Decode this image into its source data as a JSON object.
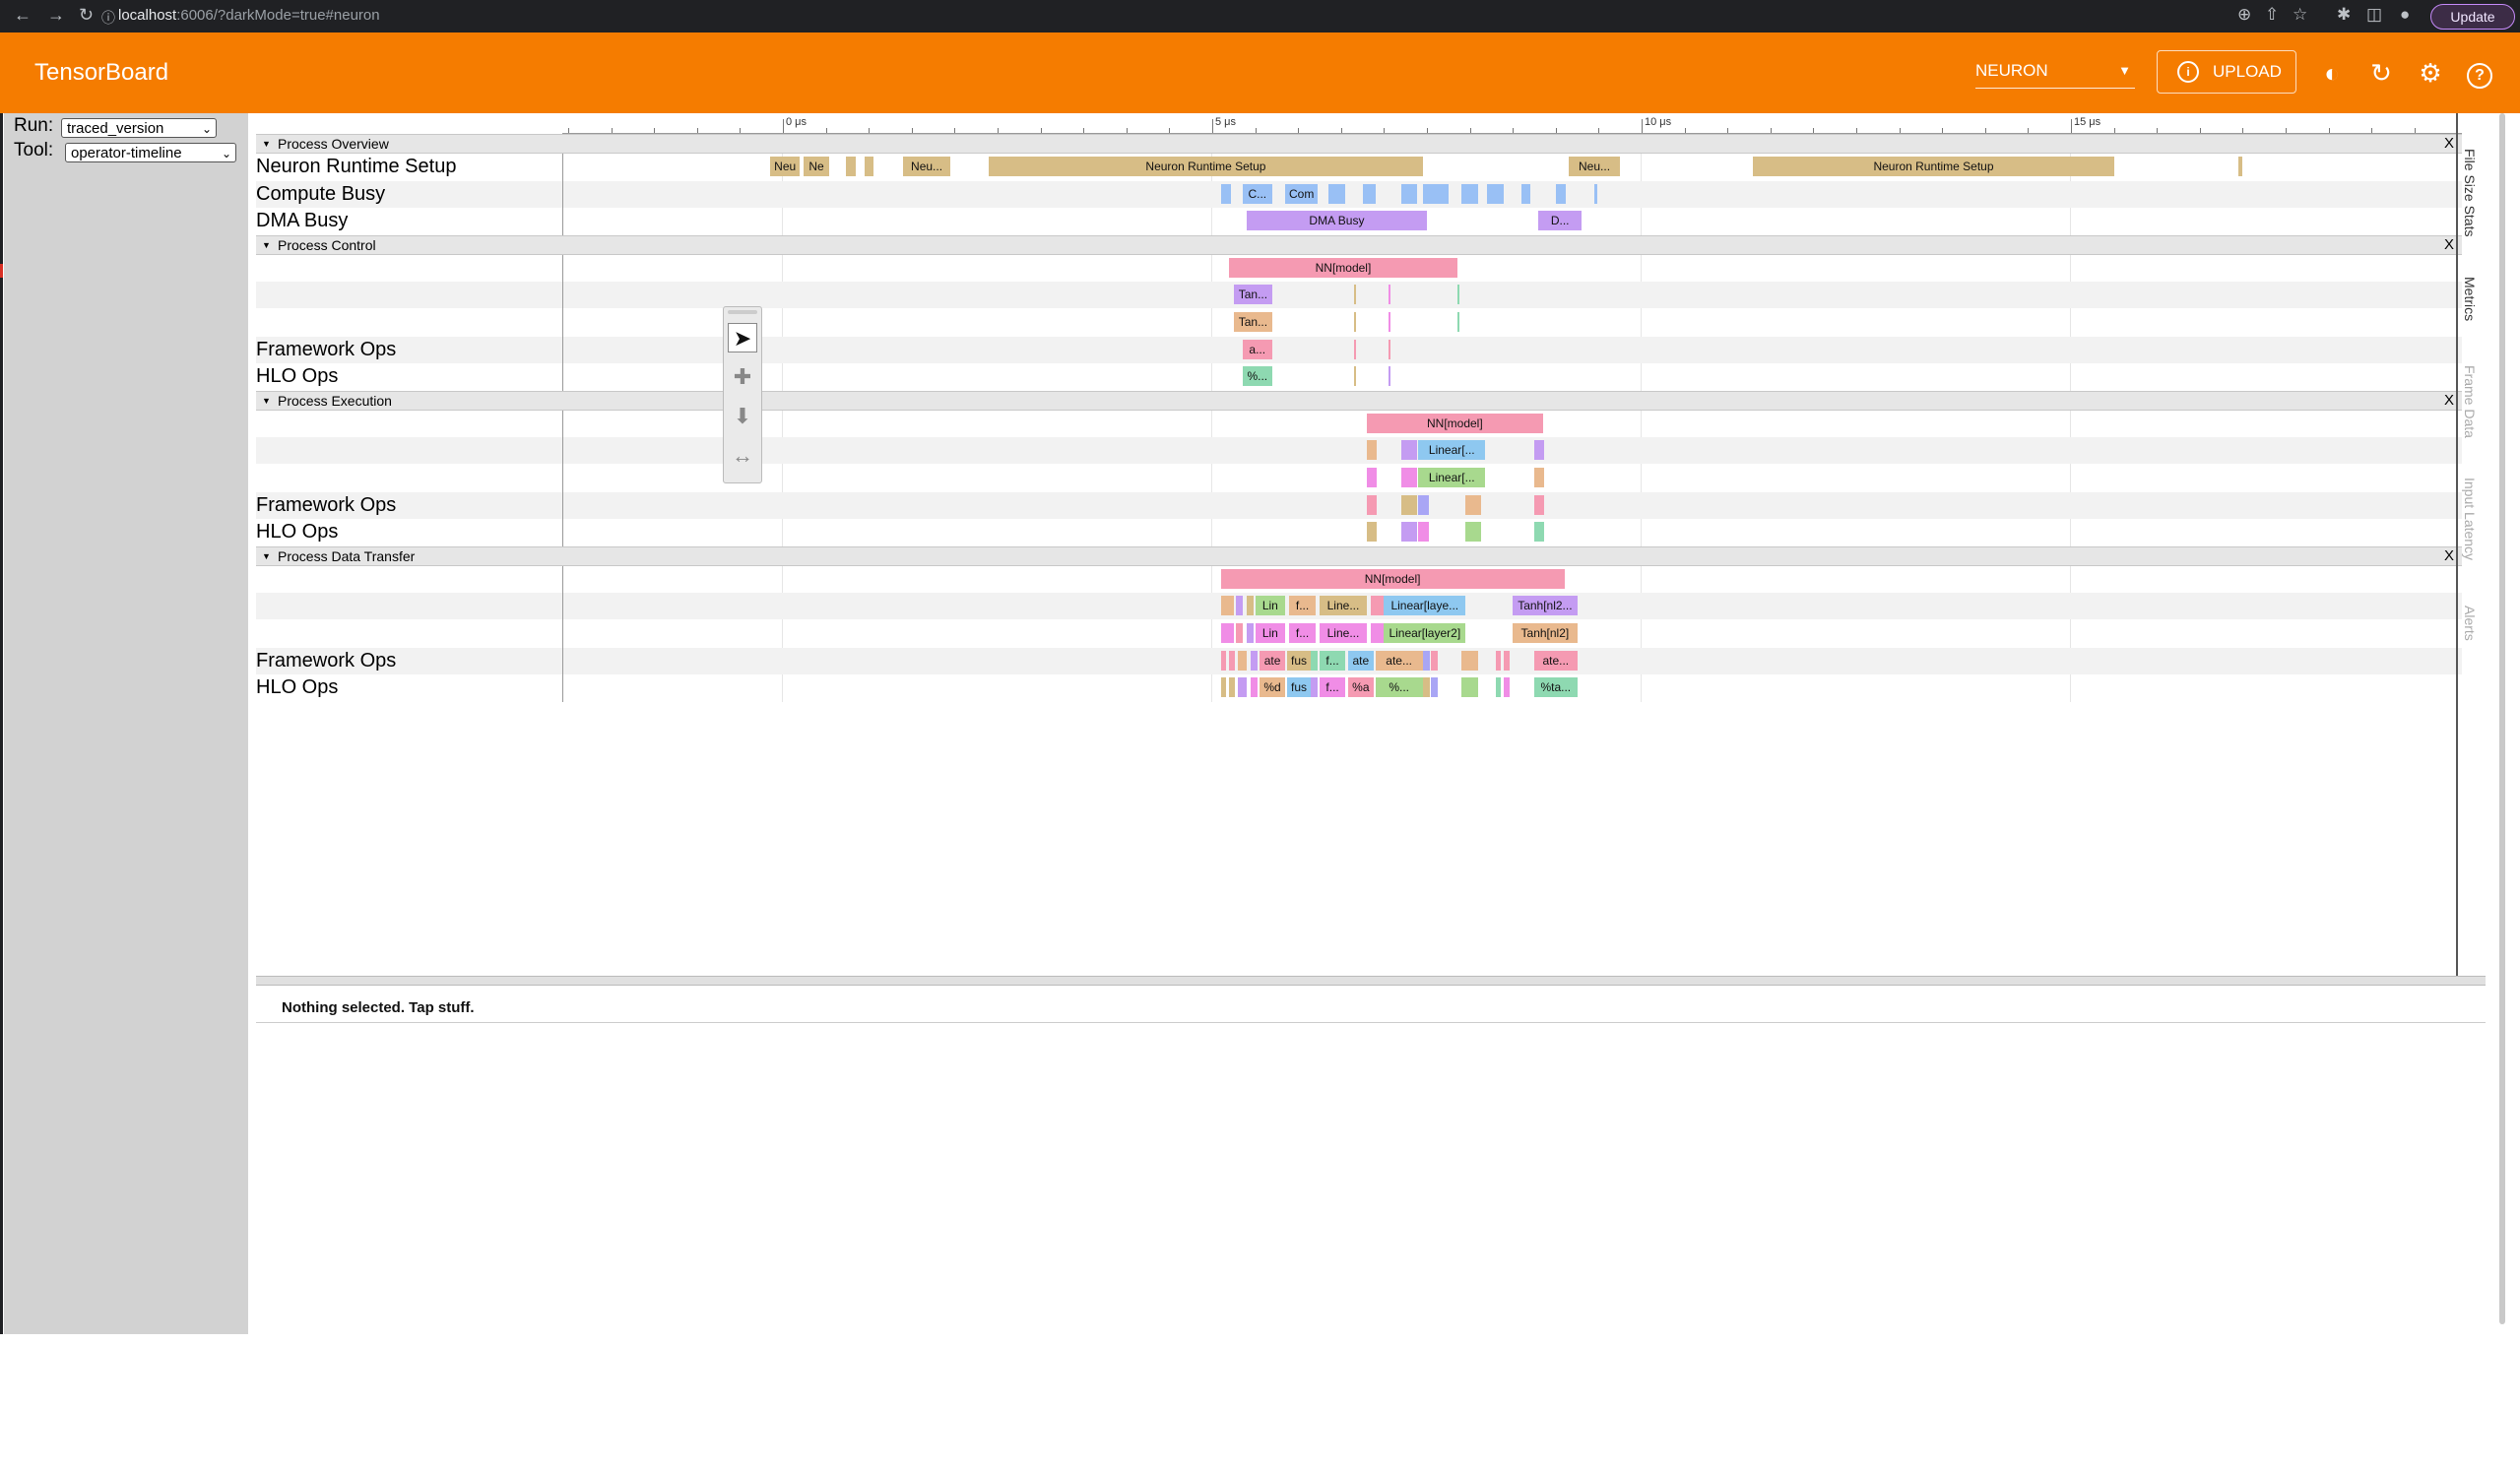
{
  "browser": {
    "url_host": "localhost",
    "url_rest": ":6006/?darkMode=true#neuron",
    "update_label": "Update"
  },
  "header": {
    "title": "TensorBoard",
    "tool_selected": "NEURON",
    "upload_label": "UPLOAD",
    "accent_color": "#f57c00"
  },
  "sidebar": {
    "run_label": "Run:",
    "run_value": "traced_version",
    "tool_label": "Tool:",
    "tool_value": "operator-timeline"
  },
  "timeline": {
    "tick_labels": [
      "0 μs",
      "5 μs",
      "10 μs",
      "15 μs"
    ]
  },
  "sections": [
    {
      "name": "Process Overview",
      "close": "X",
      "tracks": [
        {
          "label": "Neuron Runtime Setup",
          "slices": [
            {
              "s": -0.15,
              "d": 0.35,
              "text": "Neu",
              "color": "#d7bd86"
            },
            {
              "s": 0.24,
              "d": 0.3,
              "text": "Ne",
              "color": "#d7bd86"
            },
            {
              "s": 0.73,
              "d": 0.12,
              "text": "",
              "color": "#d7bd86"
            },
            {
              "s": 0.95,
              "d": 0.1,
              "text": "",
              "color": "#d7bd86"
            },
            {
              "s": 1.4,
              "d": 0.55,
              "text": "Neu...",
              "color": "#d7bd86"
            },
            {
              "s": 2.4,
              "d": 5.05,
              "text": "Neuron Runtime Setup",
              "color": "#d7bd86"
            },
            {
              "s": 9.15,
              "d": 0.6,
              "text": "Neu...",
              "color": "#d7bd86"
            },
            {
              "s": 11.3,
              "d": 4.2,
              "text": "Neuron Runtime Setup",
              "color": "#d7bd86"
            },
            {
              "s": 16.95,
              "d": 0.04,
              "text": "",
              "color": "#d7bd86"
            }
          ]
        },
        {
          "label": "Compute Busy",
          "slices": [
            {
              "s": 5.1,
              "d": 0.12,
              "text": "",
              "color": "#99c0f5"
            },
            {
              "s": 5.35,
              "d": 0.35,
              "text": "C...",
              "color": "#99c0f5"
            },
            {
              "s": 5.85,
              "d": 0.38,
              "text": "Com",
              "color": "#99c0f5"
            },
            {
              "s": 6.35,
              "d": 0.2,
              "text": "",
              "color": "#99c0f5"
            },
            {
              "s": 6.75,
              "d": 0.15,
              "text": "",
              "color": "#99c0f5"
            },
            {
              "s": 7.2,
              "d": 0.18,
              "text": "",
              "color": "#99c0f5"
            },
            {
              "s": 7.45,
              "d": 0.3,
              "text": "",
              "color": "#99c0f5"
            },
            {
              "s": 7.9,
              "d": 0.2,
              "text": "",
              "color": "#99c0f5"
            },
            {
              "s": 8.2,
              "d": 0.2,
              "text": "",
              "color": "#99c0f5"
            },
            {
              "s": 8.6,
              "d": 0.1,
              "text": "",
              "color": "#99c0f5"
            },
            {
              "s": 9.0,
              "d": 0.12,
              "text": "",
              "color": "#99c0f5"
            },
            {
              "s": 9.45,
              "d": 0.03,
              "text": "",
              "color": "#99c0f5"
            }
          ]
        },
        {
          "label": "DMA Busy",
          "slices": [
            {
              "s": 5.4,
              "d": 2.1,
              "text": "DMA Busy",
              "color": "#c49cf2"
            },
            {
              "s": 8.8,
              "d": 0.5,
              "text": "D...",
              "color": "#c49cf2"
            }
          ]
        }
      ]
    },
    {
      "name": "Process Control",
      "close": "X",
      "tracks": [
        {
          "label": "",
          "slices": [
            {
              "s": 5.2,
              "d": 2.65,
              "text": "NN[model]",
              "color": "#f59ab2"
            }
          ]
        },
        {
          "label": "",
          "slices": [
            {
              "s": 5.25,
              "d": 0.45,
              "text": "Tan...",
              "color": "#c49cf2"
            },
            {
              "s": 6.65,
              "d": 0.02,
              "text": "",
              "color": "#d7bd86"
            },
            {
              "s": 7.05,
              "d": 0.02,
              "text": "",
              "color": "#f08de6"
            },
            {
              "s": 7.85,
              "d": 0.02,
              "text": "",
              "color": "#8ed9b1"
            }
          ]
        },
        {
          "label": "",
          "slices": [
            {
              "s": 5.25,
              "d": 0.45,
              "text": "Tan...",
              "color": "#e9b98e"
            },
            {
              "s": 6.65,
              "d": 0.02,
              "text": "",
              "color": "#d7bd86"
            },
            {
              "s": 7.05,
              "d": 0.02,
              "text": "",
              "color": "#f08de6"
            },
            {
              "s": 7.85,
              "d": 0.02,
              "text": "",
              "color": "#8ed9b1"
            }
          ]
        },
        {
          "label": "Framework Ops",
          "slices": [
            {
              "s": 5.35,
              "d": 0.35,
              "text": "a...",
              "color": "#f59ab2"
            },
            {
              "s": 6.65,
              "d": 0.02,
              "text": "",
              "color": "#f59ab2"
            },
            {
              "s": 7.05,
              "d": 0.02,
              "text": "",
              "color": "#f59ab2"
            }
          ]
        },
        {
          "label": "HLO Ops",
          "slices": [
            {
              "s": 5.35,
              "d": 0.35,
              "text": "%...",
              "color": "#8ed9b1"
            },
            {
              "s": 6.65,
              "d": 0.02,
              "text": "",
              "color": "#d7bd86"
            },
            {
              "s": 7.05,
              "d": 0.02,
              "text": "",
              "color": "#c49cf2"
            }
          ]
        }
      ]
    },
    {
      "name": "Process Execution",
      "close": "X",
      "tracks": [
        {
          "label": "",
          "slices": [
            {
              "s": 6.8,
              "d": 2.05,
              "text": "NN[model]",
              "color": "#f59ab2"
            }
          ]
        },
        {
          "label": "",
          "slices": [
            {
              "s": 6.8,
              "d": 0.12,
              "text": "",
              "color": "#e9b98e"
            },
            {
              "s": 7.2,
              "d": 0.18,
              "text": "",
              "color": "#c49cf2"
            },
            {
              "s": 7.4,
              "d": 0.78,
              "text": "Linear[...",
              "color": "#8ec8f0"
            },
            {
              "s": 8.75,
              "d": 0.12,
              "text": "",
              "color": "#c49cf2"
            }
          ]
        },
        {
          "label": "",
          "slices": [
            {
              "s": 6.8,
              "d": 0.12,
              "text": "",
              "color": "#f08de6"
            },
            {
              "s": 7.2,
              "d": 0.18,
              "text": "",
              "color": "#f08de6"
            },
            {
              "s": 7.4,
              "d": 0.78,
              "text": "Linear[...",
              "color": "#a8d98e"
            },
            {
              "s": 8.75,
              "d": 0.12,
              "text": "",
              "color": "#e9b98e"
            }
          ]
        },
        {
          "label": "Framework Ops",
          "slices": [
            {
              "s": 6.8,
              "d": 0.12,
              "text": "",
              "color": "#f59ab2"
            },
            {
              "s": 7.2,
              "d": 0.18,
              "text": "",
              "color": "#d7bd86"
            },
            {
              "s": 7.4,
              "d": 0.12,
              "text": "",
              "color": "#a9a6f5"
            },
            {
              "s": 7.95,
              "d": 0.18,
              "text": "",
              "color": "#e9b98e"
            },
            {
              "s": 8.75,
              "d": 0.12,
              "text": "",
              "color": "#f59ab2"
            }
          ]
        },
        {
          "label": "HLO Ops",
          "slices": [
            {
              "s": 6.8,
              "d": 0.12,
              "text": "",
              "color": "#d7bd86"
            },
            {
              "s": 7.2,
              "d": 0.18,
              "text": "",
              "color": "#c49cf2"
            },
            {
              "s": 7.4,
              "d": 0.12,
              "text": "",
              "color": "#f08de6"
            },
            {
              "s": 7.95,
              "d": 0.18,
              "text": "",
              "color": "#a8d98e"
            },
            {
              "s": 8.75,
              "d": 0.12,
              "text": "",
              "color": "#8ed9b1"
            }
          ]
        }
      ]
    },
    {
      "name": "Process Data Transfer",
      "close": "X",
      "tracks": [
        {
          "label": "",
          "slices": [
            {
              "s": 5.1,
              "d": 4.0,
              "text": "NN[model]",
              "color": "#f59ab2"
            }
          ]
        },
        {
          "label": "",
          "slices": [
            {
              "s": 5.1,
              "d": 0.15,
              "text": "",
              "color": "#e9b98e"
            },
            {
              "s": 5.28,
              "d": 0.08,
              "text": "",
              "color": "#c49cf2"
            },
            {
              "s": 5.4,
              "d": 0.08,
              "text": "",
              "color": "#d7bd86"
            },
            {
              "s": 5.5,
              "d": 0.35,
              "text": "Lin",
              "color": "#a8d98e"
            },
            {
              "s": 5.9,
              "d": 0.3,
              "text": "f...",
              "color": "#e9b98e"
            },
            {
              "s": 6.25,
              "d": 0.55,
              "text": "Line...",
              "color": "#d7bd86"
            },
            {
              "s": 6.85,
              "d": 0.15,
              "text": "",
              "color": "#f59ab2"
            },
            {
              "s": 7.0,
              "d": 0.95,
              "text": "Linear[laye...",
              "color": "#8ec8f0"
            },
            {
              "s": 8.5,
              "d": 0.75,
              "text": "Tanh[nl2...",
              "color": "#c49cf2"
            }
          ]
        },
        {
          "label": "",
          "slices": [
            {
              "s": 5.1,
              "d": 0.15,
              "text": "",
              "color": "#f08de6"
            },
            {
              "s": 5.28,
              "d": 0.08,
              "text": "",
              "color": "#f59ab2"
            },
            {
              "s": 5.4,
              "d": 0.08,
              "text": "",
              "color": "#c49cf2"
            },
            {
              "s": 5.5,
              "d": 0.35,
              "text": "Lin",
              "color": "#f08de6"
            },
            {
              "s": 5.9,
              "d": 0.3,
              "text": "f...",
              "color": "#f08de6"
            },
            {
              "s": 6.25,
              "d": 0.55,
              "text": "Line...",
              "color": "#f08de6"
            },
            {
              "s": 6.85,
              "d": 0.15,
              "text": "",
              "color": "#f08de6"
            },
            {
              "s": 7.0,
              "d": 0.95,
              "text": "Linear[layer2]",
              "color": "#a8d98e"
            },
            {
              "s": 8.5,
              "d": 0.75,
              "text": "Tanh[nl2]",
              "color": "#e9b98e"
            }
          ]
        },
        {
          "label": "Framework Ops",
          "slices": [
            {
              "s": 5.1,
              "d": 0.06,
              "text": "",
              "color": "#f59ab2"
            },
            {
              "s": 5.2,
              "d": 0.06,
              "text": "",
              "color": "#f59ab2"
            },
            {
              "s": 5.3,
              "d": 0.1,
              "text": "",
              "color": "#e9b98e"
            },
            {
              "s": 5.45,
              "d": 0.08,
              "text": "",
              "color": "#c49cf2"
            },
            {
              "s": 5.55,
              "d": 0.3,
              "text": "ate",
              "color": "#f59ab2"
            },
            {
              "s": 5.87,
              "d": 0.28,
              "text": "fus",
              "color": "#d7bd86"
            },
            {
              "s": 6.15,
              "d": 0.08,
              "text": "",
              "color": "#8ed9b1"
            },
            {
              "s": 6.25,
              "d": 0.3,
              "text": "f...",
              "color": "#8ed9b1"
            },
            {
              "s": 6.58,
              "d": 0.3,
              "text": "ate",
              "color": "#8ec8f0"
            },
            {
              "s": 6.9,
              "d": 0.55,
              "text": "ate...",
              "color": "#e9b98e"
            },
            {
              "s": 7.45,
              "d": 0.08,
              "text": "",
              "color": "#a9a6f5"
            },
            {
              "s": 7.55,
              "d": 0.08,
              "text": "",
              "color": "#f59ab2"
            },
            {
              "s": 7.9,
              "d": 0.2,
              "text": "",
              "color": "#e9b98e"
            },
            {
              "s": 8.3,
              "d": 0.06,
              "text": "",
              "color": "#f59ab2"
            },
            {
              "s": 8.4,
              "d": 0.06,
              "text": "",
              "color": "#f59ab2"
            },
            {
              "s": 8.75,
              "d": 0.5,
              "text": "ate...",
              "color": "#f59ab2"
            }
          ]
        },
        {
          "label": "HLO Ops",
          "slices": [
            {
              "s": 5.1,
              "d": 0.06,
              "text": "",
              "color": "#d7bd86"
            },
            {
              "s": 5.2,
              "d": 0.06,
              "text": "",
              "color": "#d7bd86"
            },
            {
              "s": 5.3,
              "d": 0.1,
              "text": "",
              "color": "#c49cf2"
            },
            {
              "s": 5.45,
              "d": 0.08,
              "text": "",
              "color": "#f08de6"
            },
            {
              "s": 5.55,
              "d": 0.3,
              "text": "%d",
              "color": "#e9b98e"
            },
            {
              "s": 5.87,
              "d": 0.28,
              "text": "fus",
              "color": "#8ec8f0"
            },
            {
              "s": 6.15,
              "d": 0.08,
              "text": "",
              "color": "#c49cf2"
            },
            {
              "s": 6.25,
              "d": 0.3,
              "text": "f...",
              "color": "#f08de6"
            },
            {
              "s": 6.58,
              "d": 0.3,
              "text": "%a",
              "color": "#f59ab2"
            },
            {
              "s": 6.9,
              "d": 0.55,
              "text": "%...",
              "color": "#a8d98e"
            },
            {
              "s": 7.45,
              "d": 0.08,
              "text": "",
              "color": "#d7bd86"
            },
            {
              "s": 7.55,
              "d": 0.08,
              "text": "",
              "color": "#a9a6f5"
            },
            {
              "s": 7.9,
              "d": 0.2,
              "text": "",
              "color": "#a8d98e"
            },
            {
              "s": 8.3,
              "d": 0.06,
              "text": "",
              "color": "#8ed9b1"
            },
            {
              "s": 8.4,
              "d": 0.06,
              "text": "",
              "color": "#f08de6"
            },
            {
              "s": 8.75,
              "d": 0.5,
              "text": "%ta...",
              "color": "#8ed9b1"
            }
          ]
        }
      ]
    }
  ],
  "side_tabs": [
    "File Size Stats",
    "Metrics",
    "Frame Data",
    "Input Latency",
    "Alerts"
  ],
  "status": {
    "text": "Nothing selected. Tap stuff."
  }
}
